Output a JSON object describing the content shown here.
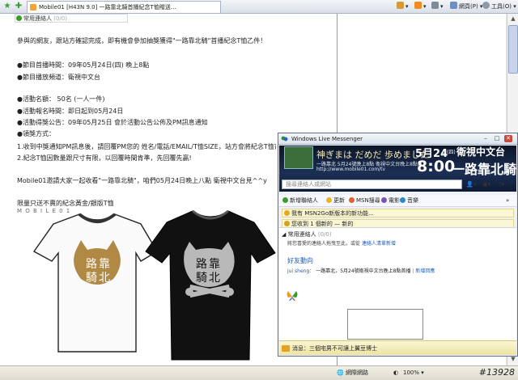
{
  "browser": {
    "tab_title": "Mobile01 [H43N 9.0] 一路靠北騎首播紀念T恤贈送…",
    "tools": {
      "page_label": "網頁(P)",
      "tools_label": "工具(O)"
    }
  },
  "page": {
    "snippet": {
      "label": "常用連絡人",
      "count": "(0/0)"
    },
    "paragraphs": [
      "參與的網友，跟站方確認完成，即有機會參加抽獎獲得\"一路靠北騎\"首播紀念T恤乙件！",
      "●節目首播時間：09年05月24日(四) 晚上8點",
      "●節目播放頻道：衛視中文台",
      "●活動名額： 50名 (一人一件)",
      "●活動報名時間：即日起到05月24日",
      "●活動得獎公告：09年05月25日 會於活動公告公佈及PM訊息通知",
      "●領獎方式：",
      "1.收到中獎通知PM訊息後，請回覆PM您的 姓名/電話/EMAIL/T恤SIZE，站方會將紀念T恤寄",
      "2.紀念T恤因數量跟尺寸有限，以回覆時間肯準，先回覆先贏!",
      "Mobile01邀請大家一起收看\"一路靠北騎\"，咱們05月24日晚上八點 衛視中文台見^^y",
      "限量只送不賣的紀念黃金/銀版T恤"
    ],
    "label_mini": "M O B I L E 0 1",
    "shirt_logo_text": [
      "路",
      "靠",
      "騎",
      "北"
    ]
  },
  "messenger": {
    "title": "Windows Live Messenger",
    "banner": {
      "headline_date": "5月24",
      "headline_day": "日(四)",
      "channel": "衛視中文台",
      "time": "8:00",
      "show_name": "一路靠北騎",
      "jp_text": "神ぎまは だめだ 歩めました",
      "sub_text": "一路靠北 5月24號晚上8點 衛視中文台晚上8點首播",
      "url": "http://www.mobile01.com/tv"
    },
    "search_placeholder": "搜尋連絡人或網站",
    "toolbar": [
      "新增聯絡人",
      "更新",
      "MSN搜尋",
      "電影",
      "音樂"
    ],
    "notices": [
      "我有 MSN2Go新版本的新功能...",
      "您收到 1 個新的 — 新的"
    ],
    "contacts_group": "常用連絡人",
    "contacts_count": "(0/0)",
    "contacts_hint": "將您喜愛的連絡人拖曳至此，或從",
    "contacts_hint_link": "連絡人清單新增",
    "news_title": "好友動向",
    "news_author": "jui sheng：",
    "news_text": "一路靠北，5月24號衛視中文台晚上8點首播",
    "news_link": "新增回應",
    "footer": "消息：三個宅男不可讓上翼豆博士"
  },
  "status": {
    "zone": "網際網路",
    "zoom": "100%"
  },
  "watermark": "#13928",
  "colors": {
    "accent_green": "#3a9b2e",
    "msn_blue": "#1f5bb1",
    "shirt_gold": "#b08a45",
    "shirt_silver": "#b9b9b9"
  }
}
